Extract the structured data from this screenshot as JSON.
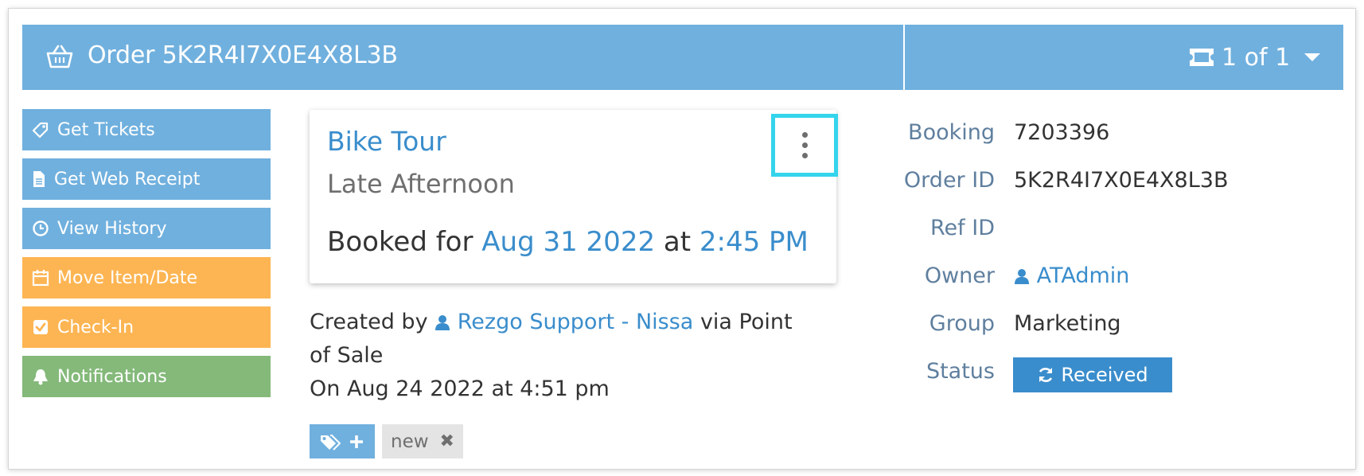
{
  "header": {
    "title": "Order 5K2R4I7X0E4X8L3B",
    "pager": "1 of 1"
  },
  "sidebar": {
    "buttons": [
      {
        "label": "Get Tickets",
        "icon": "ticket-icon",
        "color": "#70b0de"
      },
      {
        "label": "Get Web Receipt",
        "icon": "file-icon",
        "color": "#70b0de"
      },
      {
        "label": "View History",
        "icon": "clock-icon",
        "color": "#70b0de"
      },
      {
        "label": "Move Item/Date",
        "icon": "calendar-icon",
        "color": "#fdb553"
      },
      {
        "label": "Check-In",
        "icon": "check-square-icon",
        "color": "#fdb553"
      },
      {
        "label": "Notifications",
        "icon": "bell-icon",
        "color": "#84b97a"
      }
    ]
  },
  "item": {
    "title": "Bike Tour",
    "subtitle": "Late Afternoon",
    "booked_prefix": "Booked for",
    "date": "Aug 31 2022",
    "at": "at",
    "time": "2:45 PM"
  },
  "created": {
    "prefix": "Created by",
    "user": "Rezgo Support - Nissa",
    "suffix": "via Point of Sale",
    "on": "On Aug 24 2022 at 4:51 pm"
  },
  "tags": {
    "items": [
      {
        "label": "new"
      }
    ]
  },
  "details": {
    "booking_label": "Booking",
    "booking_value": "7203396",
    "order_label": "Order ID",
    "order_value": "5K2R4I7X0E4X8L3B",
    "ref_label": "Ref ID",
    "ref_value": "",
    "owner_label": "Owner",
    "owner_value": "ATAdmin",
    "group_label": "Group",
    "group_value": "Marketing",
    "status_label": "Status",
    "status_value": "Received"
  },
  "colors": {
    "header": "#70b0de",
    "link": "#3a8dcc",
    "highlight": "#34d4ec",
    "orange": "#fdb553",
    "green": "#84b97a"
  }
}
